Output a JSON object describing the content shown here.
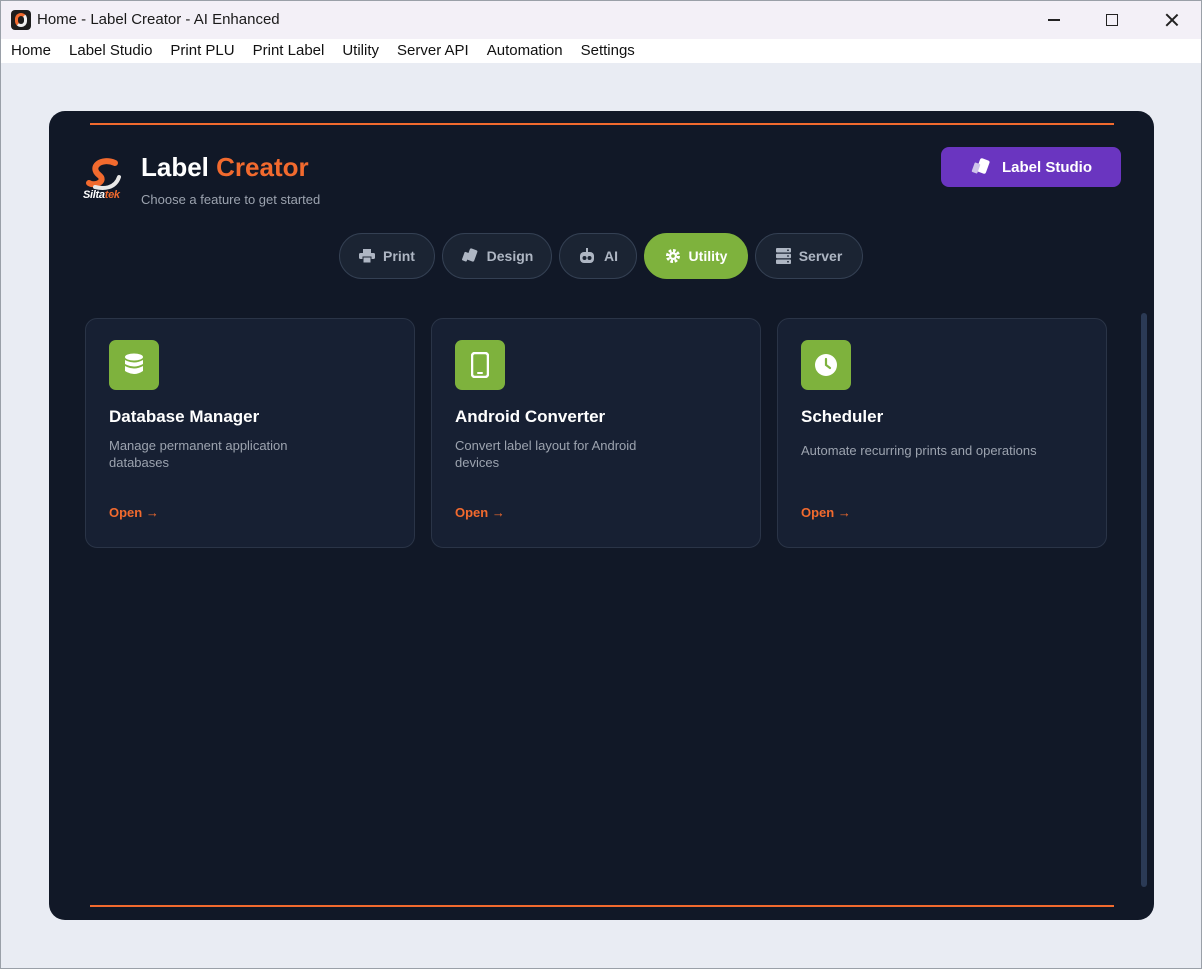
{
  "window": {
    "title": "Home - Label Creator - AI Enhanced",
    "icon": "app-s-logo"
  },
  "menu": {
    "items": [
      "Home",
      "Label Studio",
      "Print PLU",
      "Print Label",
      "Utility",
      "Server API",
      "Automation",
      "Settings"
    ]
  },
  "header": {
    "title_part1": "Label",
    "title_part2": "Creator",
    "subtitle": "Choose a feature to get started",
    "logo_text_a": "Silta",
    "logo_text_b": "tek",
    "studio_button": "Label Studio"
  },
  "tabs": [
    {
      "label": "Print",
      "icon": "printer-icon",
      "active": false
    },
    {
      "label": "Design",
      "icon": "pen-tag-icon",
      "active": false
    },
    {
      "label": "AI",
      "icon": "robot-icon",
      "active": false
    },
    {
      "label": "Utility",
      "icon": "gear-icon",
      "active": true
    },
    {
      "label": "Server",
      "icon": "server-icon",
      "active": false
    }
  ],
  "cards": [
    {
      "title": "Database Manager",
      "description": "Manage permanent application databases",
      "action": "Open →",
      "icon": "database-icon"
    },
    {
      "title": "Android Converter",
      "description": "Convert label layout for Android devices",
      "action": "Open →",
      "icon": "mobile-phone-icon"
    },
    {
      "title": "Scheduler",
      "description": "Automate recurring prints and operations",
      "action": "Open →",
      "icon": "clock-icon"
    }
  ],
  "colors": {
    "accent": "#f26a2e",
    "active_tab": "#7eb23d",
    "studio_button": "#6a35c0",
    "panel_bg": "#111827",
    "card_bg": "#172033"
  }
}
